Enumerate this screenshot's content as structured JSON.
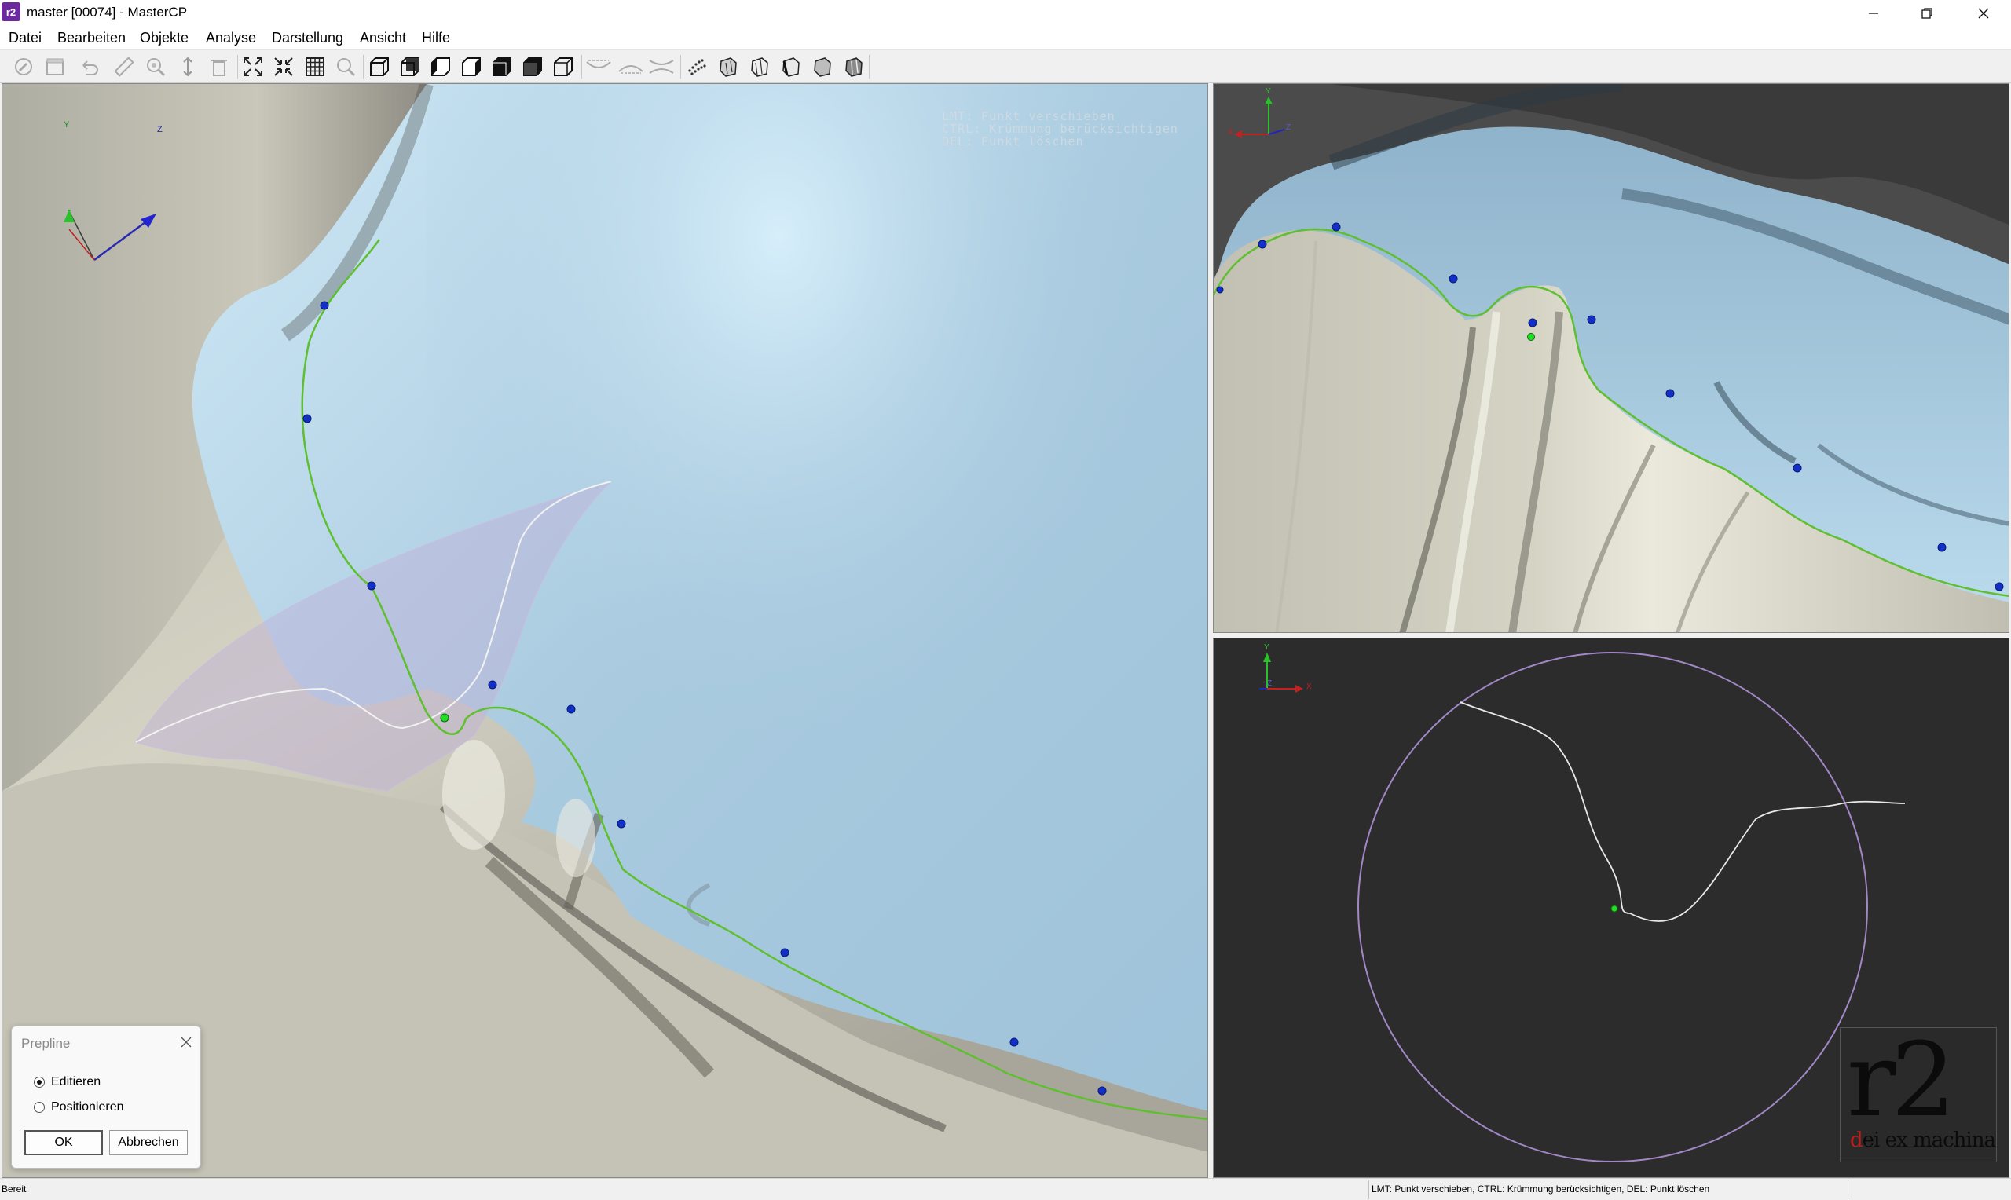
{
  "window": {
    "app_icon": "r2",
    "title": "master [00074] - MasterCP",
    "minimize_icon": "minimize-icon",
    "restore_icon": "restore-icon",
    "close_icon": "close-icon"
  },
  "menu": {
    "items": [
      {
        "label": "Datei"
      },
      {
        "label": "Bearbeiten"
      },
      {
        "label": "Objekte"
      },
      {
        "label": "Analyse"
      },
      {
        "label": "Darstellung"
      },
      {
        "label": "Ansicht"
      },
      {
        "label": "Hilfe"
      }
    ]
  },
  "toolbar": {
    "buttons": [
      "wrench-icon",
      "box-icon",
      "undo-icon",
      "ruler-icon",
      "zoom-region-icon",
      "vertical-arrows-icon",
      "trash-icon",
      "fit-view-icon",
      "shrink-view-icon",
      "grid-icon",
      "search-icon",
      "view-front-icon",
      "view-back-icon",
      "view-left-icon",
      "view-right-icon",
      "view-top-icon",
      "view-bottom-icon",
      "view-iso-icon",
      "upper-jaw-icon",
      "lower-jaw-icon",
      "both-jaws-icon",
      "points-icon",
      "solid-shade-icon",
      "wire-shade-icon",
      "shade-1-icon",
      "shade-2-icon",
      "shade-3-icon"
    ]
  },
  "viewport_main": {
    "hints": [
      "LMT: Punkt verschieben",
      "CTRL: Krümmung berücksichtigen",
      "DEL: Punkt löschen"
    ],
    "axis": {
      "y": "Y",
      "z": "Z"
    },
    "colors": {
      "prep_line": "#5fbf2f",
      "control_point": "#1230c8",
      "active_point": "#22dd22",
      "gum": "#b7d7ec",
      "tooth": "#cfcdbf"
    }
  },
  "viewport_top_right": {
    "axis": {
      "y": "Y",
      "x": "X",
      "z": "Z"
    }
  },
  "viewport_bottom_right": {
    "axis": {
      "y": "Y",
      "z": "Z",
      "x": "X"
    },
    "circle_color": "#a287c6",
    "logo": {
      "text": "r2",
      "caption_red": "d",
      "caption": "ei ex machina"
    }
  },
  "dialog": {
    "title": "Prepline",
    "options": [
      {
        "label": "Editieren",
        "checked": true
      },
      {
        "label": "Positionieren",
        "checked": false
      }
    ],
    "ok_label": "OK",
    "cancel_label": "Abbrechen"
  },
  "statusbar": {
    "left": "Bereit",
    "right": "LMT: Punkt verschieben, CTRL: Krümmung berücksichtigen, DEL: Punkt löschen"
  }
}
